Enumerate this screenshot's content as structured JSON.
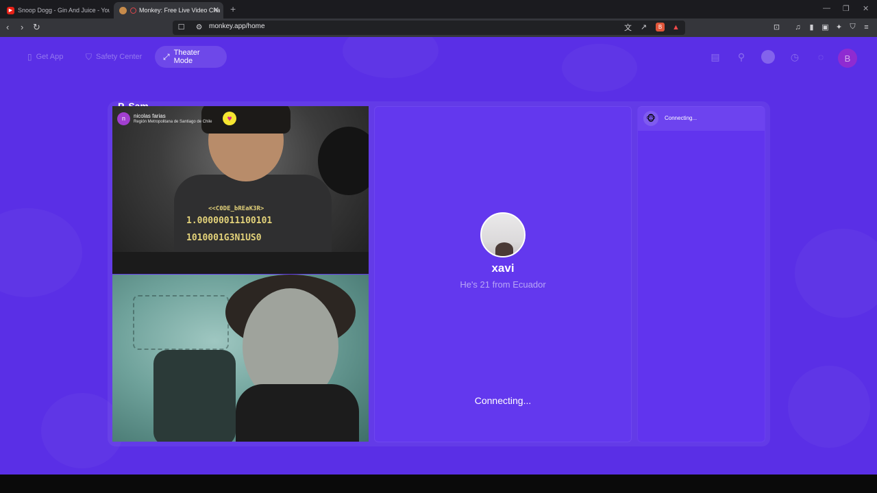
{
  "browser": {
    "tabs": [
      {
        "title": "Snoop Dogg - Gin And Juice - YouTu",
        "active": false,
        "favicon": "youtube-icon"
      },
      {
        "title": "Monkey: Free Live Video Cha",
        "active": true,
        "favicon": "monkey-icon"
      }
    ],
    "url": "monkey.app/home"
  },
  "nav": {
    "get_app": "Get App",
    "safety_center": "Safety Center",
    "theater_mode": "Theater Mode"
  },
  "user": {
    "initial": "B"
  },
  "partner": {
    "initial": "n",
    "name": "nicolas farias",
    "location": "Región Metropolitana de Santiago de Chile",
    "label_top": "P. Sam"
  },
  "shirt": {
    "line1": "<<C0DE_bREaK3R>",
    "line2": "1.00000011100101",
    "line3": "1010001G3N1US0"
  },
  "next_match": {
    "name": "xavi",
    "info": "He's 21 from Ecuador",
    "status": "Connecting..."
  },
  "chat": {
    "status": "Connecting..."
  },
  "colors": {
    "page_bg": "#5a2fe6",
    "panel_bg": "#6338ee",
    "avatar_b": "#8f2bd1"
  }
}
